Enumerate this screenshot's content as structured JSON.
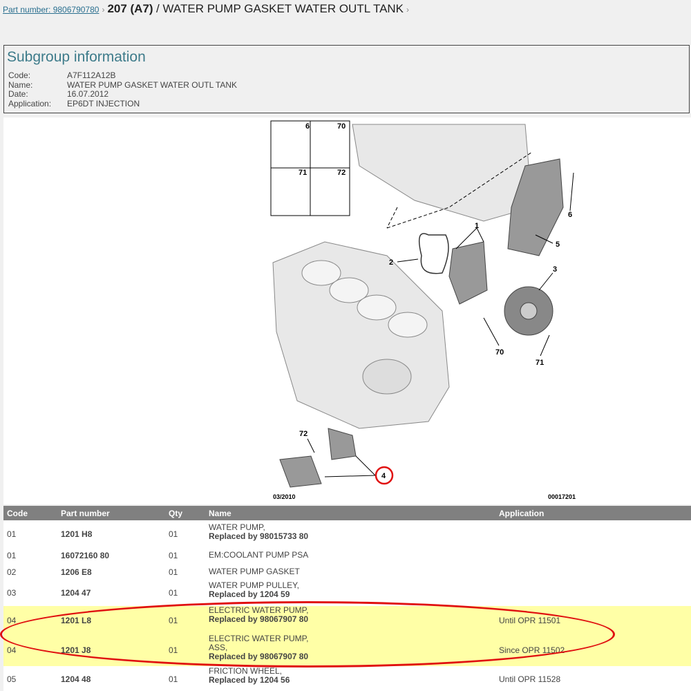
{
  "breadcrumb": {
    "part_link": "Part number: 9806790780",
    "model": "207 (A7)",
    "title": "/ WATER PUMP GASKET WATER OUTL TANK"
  },
  "subgroup": {
    "heading": "Subgroup information",
    "fields": [
      {
        "label": "Code:",
        "value": "A7F112A12B"
      },
      {
        "label": "Name:",
        "value": "WATER PUMP GASKET WATER OUTL TANK"
      },
      {
        "label": "Date:",
        "value": "16.07.2012"
      },
      {
        "label": "Application:",
        "value": "EP6DT INJECTION"
      }
    ]
  },
  "diagram": {
    "inset_labels": [
      "6",
      "70",
      "71",
      "72"
    ],
    "callouts": [
      "1",
      "2",
      "3",
      "4",
      "5",
      "6",
      "70",
      "71",
      "72"
    ],
    "date": "03/2010",
    "ref": "00017201",
    "highlight_color": "#e01010"
  },
  "table": {
    "headers": [
      "Code",
      "Part number",
      "Qty",
      "Name",
      "Application"
    ],
    "rows": [
      {
        "code": "01",
        "part": "1201 H8",
        "qty": "01",
        "name": "WATER PUMP,",
        "replaced": "Replaced by 98015733 80",
        "app": ""
      },
      {
        "code": "01",
        "part": "16072160 80",
        "qty": "01",
        "name": "EM:COOLANT PUMP PSA",
        "replaced": "",
        "app": ""
      },
      {
        "code": "02",
        "part": "1206 E8",
        "qty": "01",
        "name": "WATER PUMP GASKET",
        "replaced": "",
        "app": ""
      },
      {
        "code": "03",
        "part": "1204 47",
        "qty": "01",
        "name": "WATER PUMP PULLEY,",
        "replaced": "Replaced by 1204 59",
        "app": ""
      },
      {
        "code": "04",
        "part": "1201 L8",
        "qty": "01",
        "name": "ELECTRIC WATER PUMP,",
        "replaced": "Replaced by 98067907 80",
        "app": "Until OPR 11501"
      },
      {
        "code": "04",
        "part": "1201 J8",
        "qty": "01",
        "name": "ELECTRIC WATER PUMP, ASS,",
        "replaced": "Replaced by 98067907 80",
        "app": "Since OPR 11502"
      },
      {
        "code": "05",
        "part": "1204 48",
        "qty": "01",
        "name": "FRICTION WHEEL,",
        "replaced": "Replaced by 1204 56",
        "app": "Until OPR 11528"
      }
    ]
  }
}
